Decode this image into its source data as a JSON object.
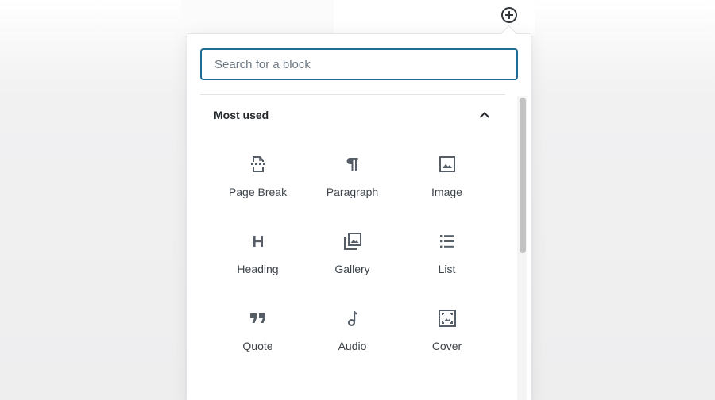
{
  "inserter": {
    "toggle_icon": "plus-circle-icon",
    "search": {
      "placeholder": "Search for a block",
      "value": ""
    },
    "panel": {
      "title": "Most used",
      "expanded": true,
      "blocks": [
        {
          "label": "Page Break",
          "icon": "page-break-icon"
        },
        {
          "label": "Paragraph",
          "icon": "paragraph-icon"
        },
        {
          "label": "Image",
          "icon": "image-icon"
        },
        {
          "label": "Heading",
          "icon": "heading-icon"
        },
        {
          "label": "Gallery",
          "icon": "gallery-icon"
        },
        {
          "label": "List",
          "icon": "list-icon"
        },
        {
          "label": "Quote",
          "icon": "quote-icon"
        },
        {
          "label": "Audio",
          "icon": "audio-icon"
        },
        {
          "label": "Cover",
          "icon": "cover-icon"
        }
      ]
    }
  },
  "colors": {
    "focus_border": "#1d6c95",
    "text": "#3c434a",
    "icon": "#555d66"
  }
}
